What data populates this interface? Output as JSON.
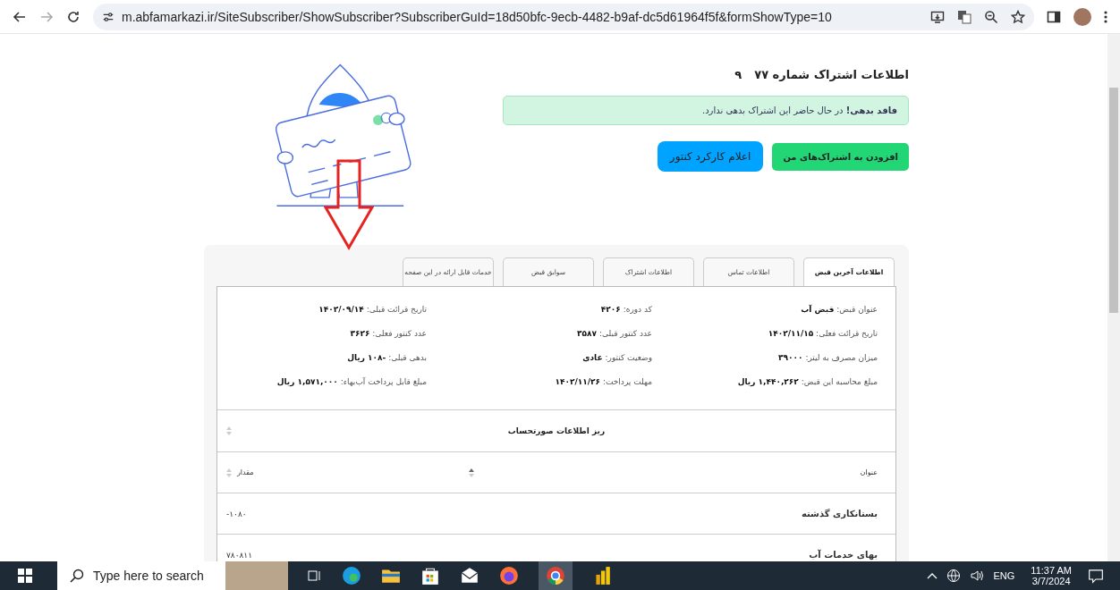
{
  "browser": {
    "url": "m.abfamarkazi.ir/SiteSubscriber/ShowSubscriber?SubscriberGuId=18d50bfc-9ecb-4482-b9af-dc5d61964f5f&formShowType=10"
  },
  "header": {
    "title": "اطلاعات اشتراک شماره ۷۷",
    "title_suffix": "۹"
  },
  "alert": {
    "text": "**فاقد بدهی!** در حال حاضر این اشتراک بدهی ندارد."
  },
  "buttons": [
    {
      "label": "افزودن به اشتراک‌های من",
      "kind": "success"
    },
    {
      "label": "اعلام کارکرد کنتور",
      "kind": "info"
    }
  ],
  "tabs": [
    {
      "label": "اطلاعات آخرین قبض",
      "selected": true
    },
    {
      "label": "اطلاعات تماس",
      "selected": false
    },
    {
      "label": "اطلاعات اشتراک",
      "selected": false
    },
    {
      "label": "سوابق قبض",
      "selected": false
    },
    {
      "label": "خدمات قابل ارائه در این صفحه",
      "selected": false
    }
  ],
  "fields": [
    {
      "label": "عنوان قبض:",
      "value": "قبض آب"
    },
    {
      "label": "کد دوره:",
      "value": "۴۲۰۶"
    },
    {
      "label": "تاریخ قرائت قبلی:",
      "value": "۱۴۰۲/۰۹/۱۴"
    },
    {
      "label": "تاریخ قرائت فعلی:",
      "value": "۱۴۰۲/۱۱/۱۵"
    },
    {
      "label": "عدد کنتور قبلی:",
      "value": "۳۵۸۷"
    },
    {
      "label": "عدد کنتور فعلی:",
      "value": "۳۶۲۶"
    },
    {
      "label": "میزان مصرف به لیتر:",
      "value": "۳۹۰۰۰"
    },
    {
      "label": "وضعیت کنتور:",
      "value": "عادی"
    },
    {
      "label": "بدهی قبلی:",
      "value": "-۱۰۸ ریال"
    },
    {
      "label": "مبلغ محاسبه این قبض:",
      "value": "۱,۴۴۰,۲۶۲ ریال"
    },
    {
      "label": "مهلت پرداخت:",
      "value": "۱۴۰۲/۱۱/۲۶"
    },
    {
      "label": "مبلغ قابل پرداخت آب‌بهاء:",
      "value": "۱,۵۷۱,۰۰۰ ریال"
    }
  ],
  "table": {
    "caption": "ریز اطلاعات صورتحساب",
    "columns": [
      "عنوان",
      "مقدار"
    ],
    "rows": [
      [
        "بستانکاری گذشته",
        "-۱۰۸۰"
      ],
      [
        "بهای خدمات آب",
        "۷۸۰۸۱۱"
      ]
    ]
  },
  "taskbar": {
    "search_placeholder": "Type here to search",
    "language": "ENG",
    "time": "11:37 AM",
    "date": "3/7/2024"
  }
}
